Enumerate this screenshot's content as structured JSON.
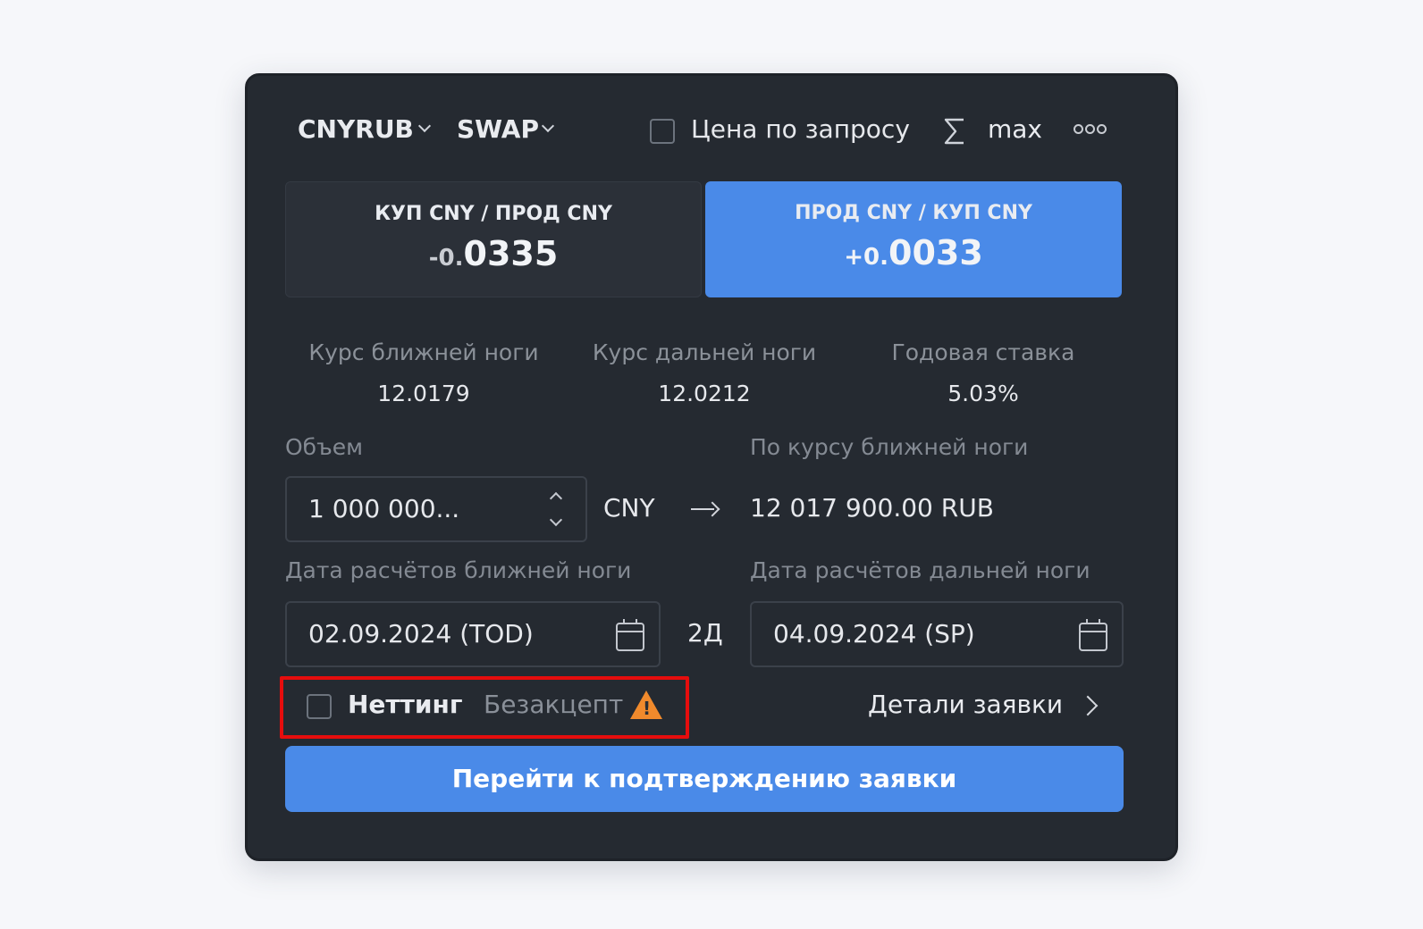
{
  "header": {
    "pair": "CNYRUB",
    "instrument": "SWAP",
    "price_on_request_label": "Цена по запросу",
    "sum_icon": "sigma-icon",
    "max_label": "max",
    "more_icon": "more-dots-icon"
  },
  "sides": {
    "buy": {
      "label": "КУП CNY / ПРОД CNY",
      "value_prefix": "-0.",
      "value_main": "0335"
    },
    "sell": {
      "label": "ПРОД CNY / КУП CNY",
      "value_prefix": "+0.",
      "value_main": "0033",
      "selected": true
    }
  },
  "stats": [
    {
      "label": "Курс ближней ноги",
      "value": "12.0179"
    },
    {
      "label": "Курс дальней ноги",
      "value": "12.0212"
    },
    {
      "label": "Годовая ставка",
      "value": "5.03%"
    }
  ],
  "volume": {
    "label": "Объем",
    "value": "1 000 000...",
    "currency": "CNY",
    "conversion_label": "По курсу ближней ноги",
    "converted": "12 017 900.00 RUB"
  },
  "dates": {
    "near_label": "Дата расчётов ближней ноги",
    "near_value": "02.09.2024 (TOD)",
    "tenor": "2Д",
    "far_label": "Дата расчётов дальней ноги",
    "far_value": "04.09.2024 (SP)"
  },
  "options": {
    "netting_label": "Неттинг",
    "no_accept_label": "Безакцепт",
    "details_label": "Детали заявки"
  },
  "submit_label": "Перейти к подтверждению заявки",
  "colors": {
    "panel": "#252a31",
    "accent": "#4a8ae8",
    "warning": "#f08a2c",
    "highlight": "#e60d0d"
  }
}
